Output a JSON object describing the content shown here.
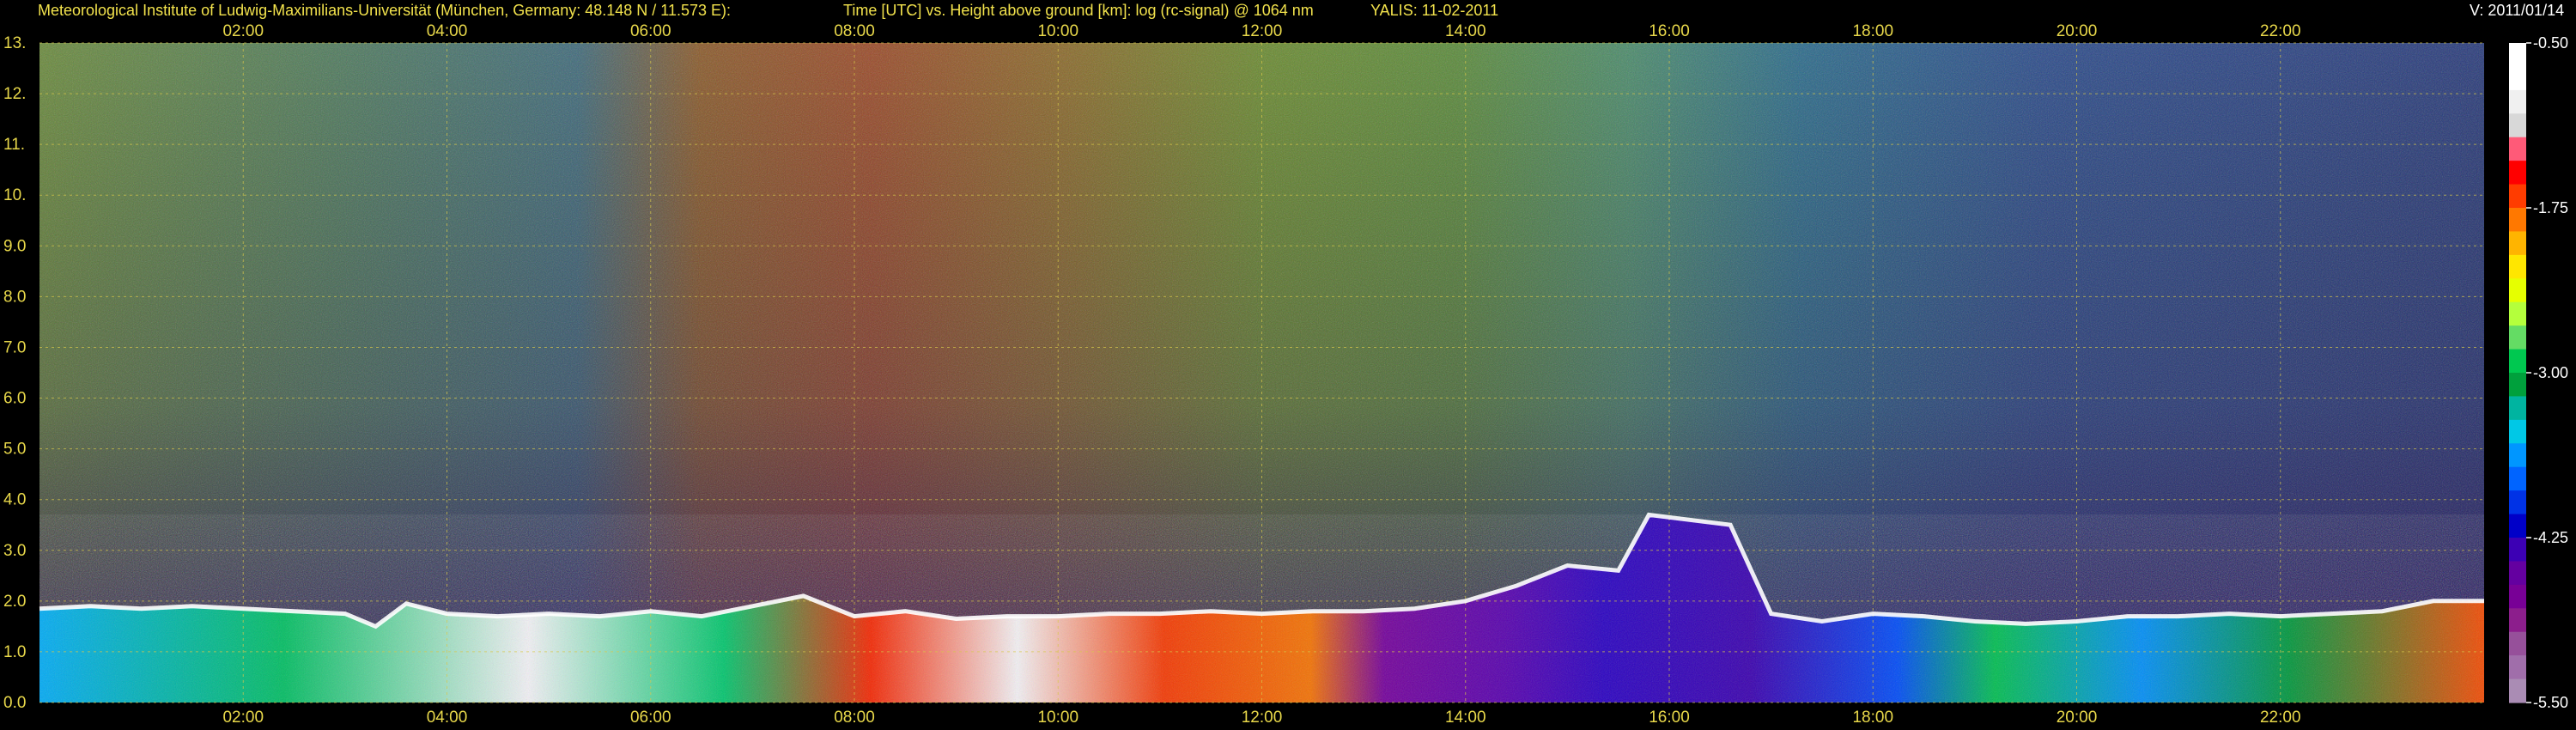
{
  "header": {
    "institute": "Meteorological Institute of Ludwig-Maximilians-Universität (München, Germany: 48.148 N / 11.573 E):",
    "description": "Time [UTC] vs. Height above ground [km]: log (rc-signal) @ 1064 nm",
    "instrument": "YALIS: 11-02-2011",
    "version": "V: 2011/01/14"
  },
  "chart_data": {
    "type": "heatmap",
    "title": "Time [UTC] vs. Height above ground [km]: log (rc-signal) @ 1064 nm",
    "xlabel": "Time [UTC]",
    "ylabel": "Height above ground [km]",
    "x_range_hours": [
      0.0,
      24.0
    ],
    "x_tick_labels": [
      "02:00",
      "04:00",
      "06:00",
      "08:00",
      "10:00",
      "12:00",
      "14:00",
      "16:00",
      "18:00",
      "20:00",
      "22:00"
    ],
    "x_tick_hours": [
      2,
      4,
      6,
      8,
      10,
      12,
      14,
      16,
      18,
      20,
      22
    ],
    "y_range_km": [
      0.0,
      13.0
    ],
    "y_tick_labels": [
      "0.0",
      "1.0",
      "2.0",
      "3.0",
      "4.0",
      "5.0",
      "6.0",
      "7.0",
      "8.0",
      "9.0",
      "10.",
      "11.",
      "12.",
      "13."
    ],
    "y_tick_values": [
      0,
      1,
      2,
      3,
      4,
      5,
      6,
      7,
      8,
      9,
      10,
      11,
      12,
      13
    ],
    "grid": true,
    "colorbar": {
      "range": [
        -5.5,
        -0.5
      ],
      "tick_labels": [
        "-0.50",
        "-1.75",
        "-3.00",
        "-4.25",
        "-5.50"
      ],
      "tick_values": [
        -0.5,
        -1.75,
        -3.0,
        -4.25,
        -5.5
      ],
      "colors": [
        "#ffffff",
        "#ffffff",
        "#f0f0f0",
        "#d8d8d8",
        "#ff5a78",
        "#ff0000",
        "#ff3c00",
        "#ff7800",
        "#ffb400",
        "#ffe600",
        "#e6ff00",
        "#b4ff3c",
        "#64dc64",
        "#00c850",
        "#00a03c",
        "#00b4a0",
        "#00c8e6",
        "#0096ff",
        "#0064ff",
        "#0032e6",
        "#0000c8",
        "#3c00b4",
        "#6400a0",
        "#780096",
        "#8c1e8c",
        "#96509a",
        "#a06eaa",
        "#aa8cb4"
      ]
    },
    "features": {
      "boundary_layer_top_km": [
        [
          0.0,
          1.85
        ],
        [
          0.5,
          1.9
        ],
        [
          1.0,
          1.85
        ],
        [
          1.5,
          1.9
        ],
        [
          2.0,
          1.85
        ],
        [
          2.5,
          1.8
        ],
        [
          3.0,
          1.75
        ],
        [
          3.3,
          1.5
        ],
        [
          3.6,
          1.95
        ],
        [
          4.0,
          1.75
        ],
        [
          4.5,
          1.7
        ],
        [
          5.0,
          1.75
        ],
        [
          5.5,
          1.7
        ],
        [
          6.0,
          1.8
        ],
        [
          6.5,
          1.7
        ],
        [
          7.0,
          1.9
        ],
        [
          7.5,
          2.1
        ],
        [
          8.0,
          1.7
        ],
        [
          8.5,
          1.8
        ],
        [
          9.0,
          1.65
        ],
        [
          9.5,
          1.7
        ],
        [
          10.0,
          1.7
        ],
        [
          10.5,
          1.75
        ],
        [
          11.0,
          1.75
        ],
        [
          11.5,
          1.8
        ],
        [
          12.0,
          1.75
        ],
        [
          12.5,
          1.8
        ],
        [
          13.0,
          1.8
        ],
        [
          13.5,
          1.85
        ],
        [
          14.0,
          2.0
        ],
        [
          14.5,
          2.3
        ],
        [
          15.0,
          2.7
        ],
        [
          15.5,
          2.6
        ],
        [
          15.8,
          3.7
        ],
        [
          16.2,
          3.6
        ],
        [
          16.6,
          3.5
        ],
        [
          17.0,
          1.75
        ],
        [
          17.5,
          1.6
        ],
        [
          18.0,
          1.75
        ],
        [
          18.5,
          1.7
        ],
        [
          19.0,
          1.6
        ],
        [
          19.5,
          1.55
        ],
        [
          20.0,
          1.6
        ],
        [
          20.5,
          1.7
        ],
        [
          21.0,
          1.7
        ],
        [
          21.5,
          1.75
        ],
        [
          22.0,
          1.7
        ],
        [
          22.5,
          1.75
        ],
        [
          23.0,
          1.8
        ],
        [
          23.5,
          2.0
        ],
        [
          24.0,
          2.0
        ]
      ]
    }
  }
}
